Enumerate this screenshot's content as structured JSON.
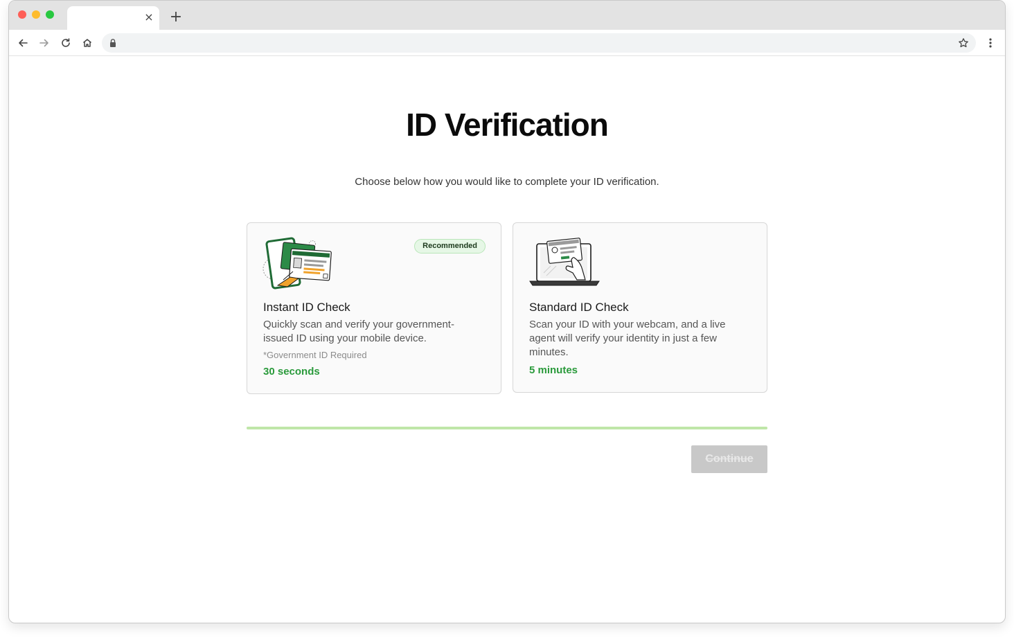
{
  "browser": {
    "tab_title": "",
    "tab_close_icon": "×",
    "new_tab_icon": "+",
    "url": ""
  },
  "page": {
    "title": "ID Verification",
    "subtitle": "Choose below how you would like to complete your ID verification."
  },
  "options": [
    {
      "title": "Instant ID Check",
      "badge": "Recommended",
      "description": "Quickly scan and verify your government-issued ID using your mobile device.",
      "note": "*Government ID Required",
      "time": "30 seconds",
      "illustration": "phone-with-id-cards-illustration"
    },
    {
      "title": "Standard ID Check",
      "description": "Scan your ID with your webcam, and a live agent will verify your identity in just a few minutes.",
      "time": "5 minutes",
      "illustration": "laptop-with-id-card-illustration"
    }
  ],
  "progress": {
    "value": 1.0
  },
  "actions": {
    "continue_label": "Continue",
    "continue_enabled": false
  },
  "colors": {
    "accent_green": "#2a9a3b",
    "badge_bg": "#e6f7e6",
    "button_disabled": "#c8c8c8"
  }
}
